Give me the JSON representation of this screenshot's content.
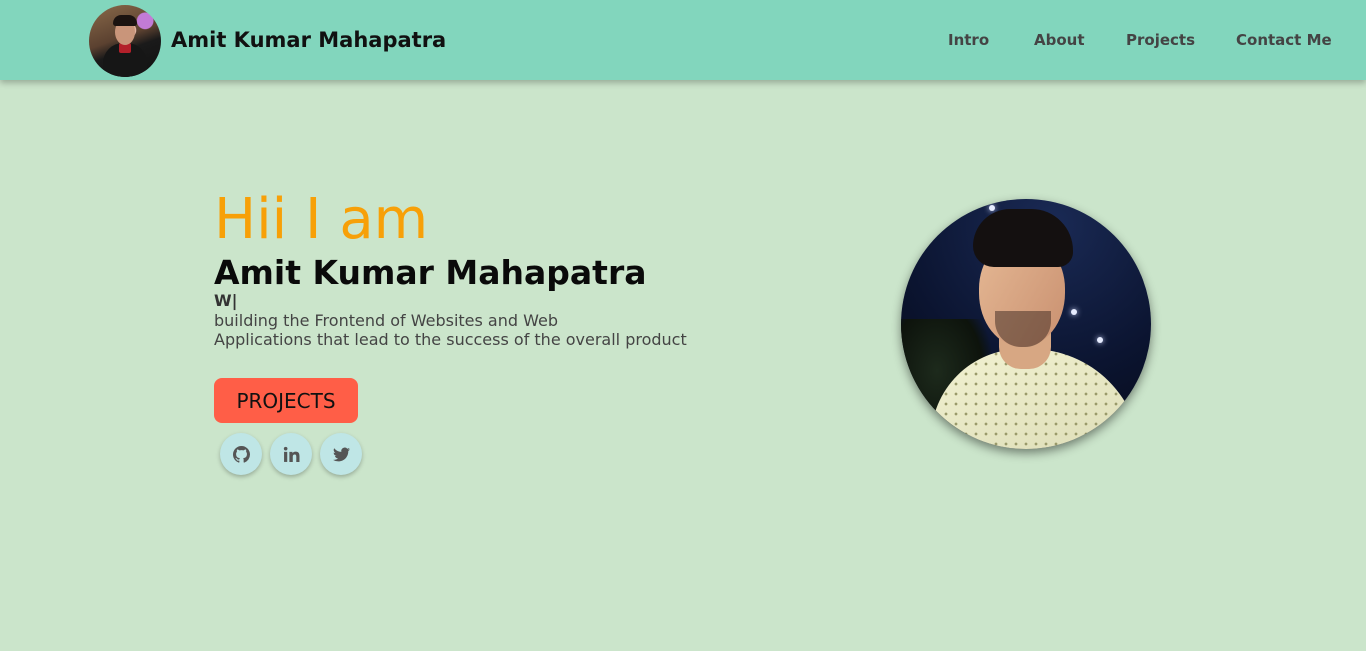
{
  "header": {
    "brand_name": "Amit Kumar Mahapatra",
    "nav": [
      {
        "label": "Intro"
      },
      {
        "label": "About"
      },
      {
        "label": "Projects"
      },
      {
        "label": "Contact Me"
      }
    ]
  },
  "hero": {
    "greeting": "Hii I am",
    "name": "Amit Kumar Mahapatra",
    "typed_text": "W|",
    "description_line1": "building the Frontend of Websites and Web",
    "description_line2": "Applications that lead to the success of the overall product",
    "projects_button": "PROJECTS",
    "social_icons": [
      "github-icon",
      "linkedin-icon",
      "twitter-icon"
    ]
  },
  "colors": {
    "header_bg": "#82d6bd",
    "page_bg": "#cbe5cb",
    "greeting": "#f7a008",
    "button_bg": "#ff5e47",
    "social_bg": "#bfe6e6"
  }
}
